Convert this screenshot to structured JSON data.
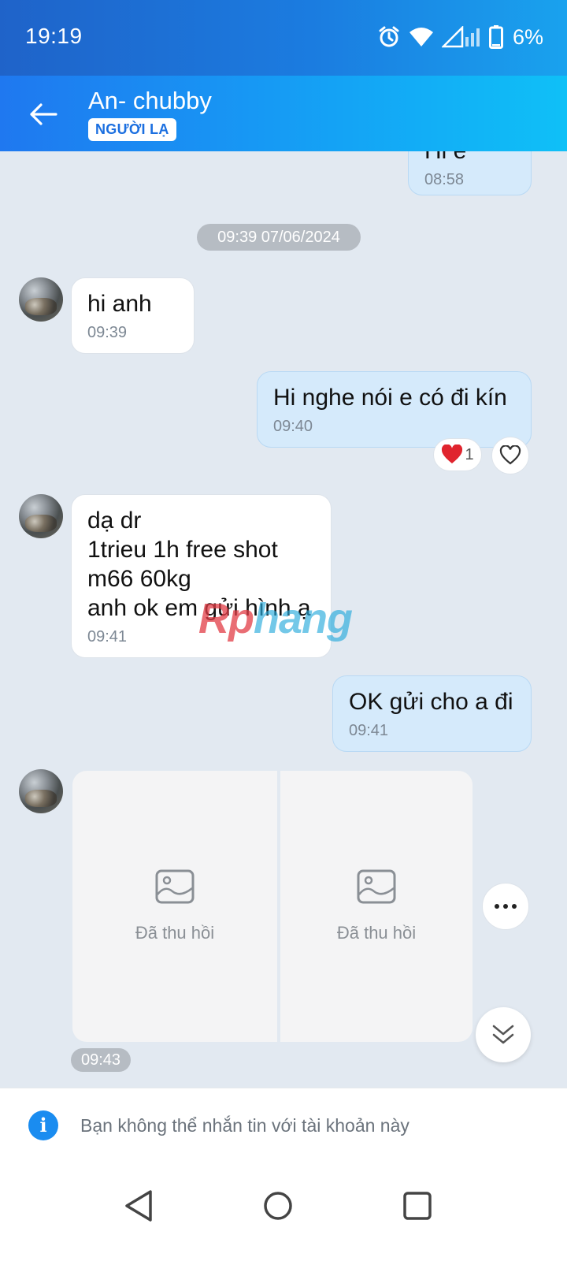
{
  "status_bar": {
    "time": "19:19",
    "battery": "6%",
    "icons": [
      "alarm-icon",
      "wifi-icon",
      "signal-icon",
      "battery-icon"
    ]
  },
  "header": {
    "contact_name": "An- chubby",
    "badge": "NGƯỜI LẠ"
  },
  "chat": {
    "partial_top_message": {
      "text": "Hi e",
      "time": "08:58"
    },
    "date_separator": "09:39 07/06/2024",
    "messages": [
      {
        "dir": "in",
        "text": "hi anh",
        "time": "09:39"
      },
      {
        "dir": "out",
        "text": "Hi nghe nói e có đi kín",
        "time": "09:40",
        "reaction_count": "1"
      },
      {
        "dir": "in",
        "text": "dạ dr\n1trieu 1h free shot\nm66 60kg\nanh ok em gửi hình ạ",
        "time": "09:41"
      },
      {
        "dir": "out",
        "text": "OK gửi cho a đi",
        "time": "09:41"
      }
    ],
    "recalled_images": [
      {
        "label": "Đã thu hồi"
      },
      {
        "label": "Đã thu hồi"
      }
    ],
    "images_time": "09:43"
  },
  "watermark": {
    "part1": "Rp",
    "part2": "hang"
  },
  "notice": {
    "text": "Bạn không thể nhắn tin với tài khoản này"
  },
  "colors": {
    "accent": "#1a8cf0",
    "header_start": "#1f78f0",
    "header_end": "#0fc0f7",
    "out_bubble": "#d5eafb"
  }
}
